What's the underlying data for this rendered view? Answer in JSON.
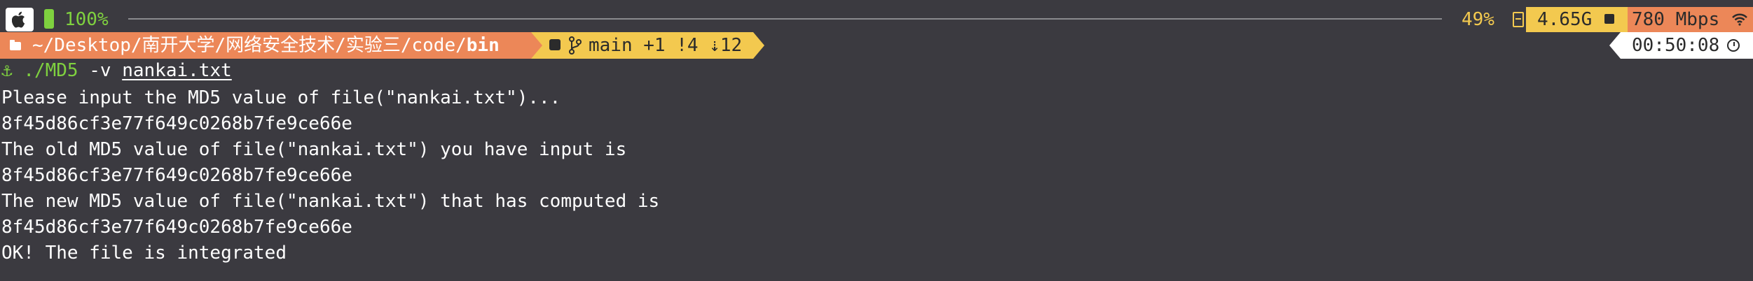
{
  "status_bar": {
    "apple_icon": "apple-logo-icon",
    "battery_icon": "battery-icon",
    "battery": "100%",
    "cpu": "49%",
    "drive_icon": "drive-icon",
    "memory": "4.65G",
    "memory_icon": "memory-chip-icon",
    "network": "780 Mbps",
    "network_icon": "wifi-icon"
  },
  "prompt": {
    "folder_icon": "folder-icon",
    "path_prefix": "~/Desktop/南开大学/网络安全技术/实验三/code/",
    "path_current": "bin",
    "git_icon": "git-cat-icon",
    "branch_icon": "git-branch-icon",
    "git_status": "main +1 !4 ⇣12",
    "time": "00:50:08",
    "clock_icon": "clock-icon",
    "anchor_icon": "⚓",
    "command": "./MD5",
    "command_flag": " -v ",
    "command_file": "nankai.txt"
  },
  "output": [
    "Please input the MD5 value of file(\"nankai.txt\")...",
    "8f45d86cf3e77f649c0268b7fe9ce66e",
    "The old MD5 value of file(\"nankai.txt\") you have input is",
    "8f45d86cf3e77f649c0268b7fe9ce66e",
    "The new MD5 value of file(\"nankai.txt\") that has computed is",
    "8f45d86cf3e77f649c0268b7fe9ce66e",
    "OK! The file is integrated"
  ],
  "colors": {
    "background": "#3b3a40",
    "orange_segment": "#ec8758",
    "yellow_segment": "#f3c94f",
    "green": "#7fd13f"
  }
}
